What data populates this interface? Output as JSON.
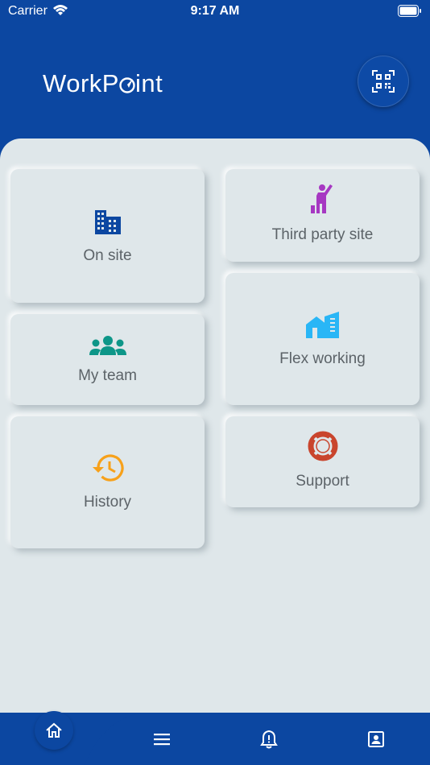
{
  "status_bar": {
    "carrier": "Carrier",
    "time": "9:17 AM"
  },
  "header": {
    "logo_text_start": "WorkP",
    "logo_text_end": "int"
  },
  "tiles": [
    {
      "label": "On site",
      "icon": "building-icon",
      "color": "#0c47a1"
    },
    {
      "label": "Third party site",
      "icon": "person-waving-icon",
      "color": "#a638c2"
    },
    {
      "label": "My team",
      "icon": "group-icon",
      "color": "#0d9688"
    },
    {
      "label": "Flex working",
      "icon": "house-building-icon",
      "color": "#29b6f6"
    },
    {
      "label": "History",
      "icon": "history-icon",
      "color": "#f7a11a"
    },
    {
      "label": "Support",
      "icon": "lifebuoy-icon",
      "color": "#c9452d"
    }
  ],
  "nav": {
    "items": [
      "home-icon",
      "menu-icon",
      "bell-alert-icon",
      "contact-card-icon"
    ]
  },
  "colors": {
    "brand": "#0c47a1",
    "background": "#dfe7ea",
    "label": "#5c6368"
  }
}
